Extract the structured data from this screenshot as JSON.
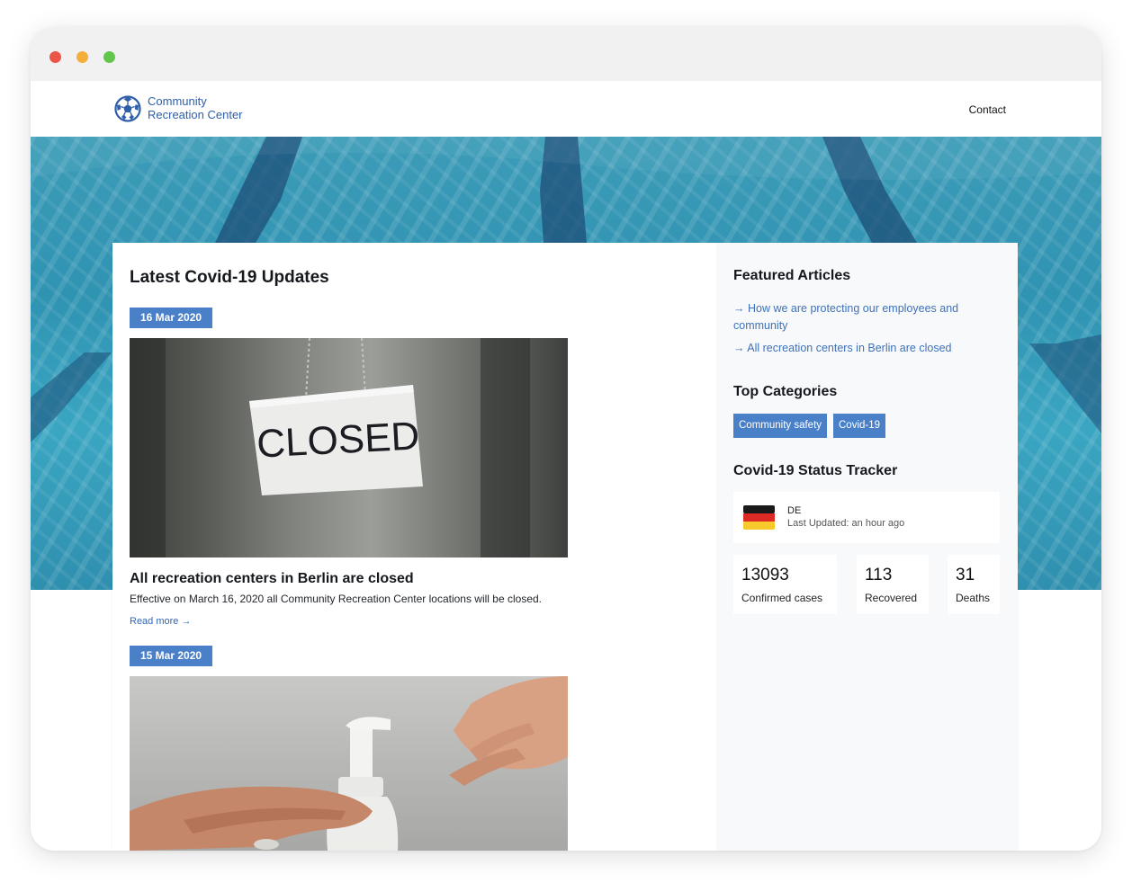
{
  "site": {
    "brand_line1": "Community",
    "brand_line2": "Recreation Center",
    "logo_icon": "soccer-ball-icon",
    "nav_contact": "Contact"
  },
  "colors": {
    "accent": "#4a80c8",
    "brand_text": "#2f5fa8",
    "link": "#3f71b9"
  },
  "main": {
    "title": "Latest Covid-19 Updates",
    "posts": [
      {
        "date": "16 Mar 2020",
        "image": "closed-sign-photo",
        "image_text": "CLOSED",
        "title": "All recreation centers in Berlin are closed",
        "excerpt": "Effective on March 16, 2020 all Community Recreation Center locations will be closed.",
        "read_more": "Read more →"
      },
      {
        "date": "15 Mar 2020",
        "image": "hand-sanitizer-photo"
      }
    ]
  },
  "sidebar": {
    "featured_title": "Featured Articles",
    "featured": [
      "→ How we are protecting our employees and community",
      "→ All recreation centers in Berlin are closed"
    ],
    "categories_title": "Top Categories",
    "categories": [
      "Community safety",
      "Covid-19"
    ],
    "tracker_title": "Covid-19 Status Tracker",
    "tracker": {
      "country": "DE",
      "flag_icon": "germany-flag-icon",
      "updated": "Last Updated: an hour ago",
      "stats": [
        {
          "value": "13093",
          "label": "Confirmed cases"
        },
        {
          "value": "113",
          "label": "Recovered"
        },
        {
          "value": "31",
          "label": "Deaths"
        }
      ]
    }
  }
}
